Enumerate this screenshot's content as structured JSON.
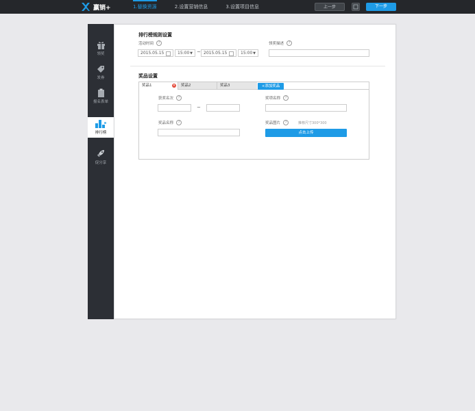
{
  "header": {
    "brand": "赢销+",
    "steps": [
      "1.替换资源",
      "2.设置营销信息",
      "3.设置项目信息"
    ],
    "prev_label": "上一步",
    "next_label": "下一步"
  },
  "sidebar": {
    "items": [
      {
        "label": "领奖",
        "icon": "gift-icon"
      },
      {
        "label": "发券",
        "icon": "tag-icon"
      },
      {
        "label": "报名表单",
        "icon": "clipboard-icon"
      },
      {
        "label": "排行榜",
        "icon": "ranking-icon",
        "active": true
      },
      {
        "label": "促分享",
        "icon": "rocket-icon"
      }
    ]
  },
  "rules": {
    "title": "排行榜规则设置",
    "time_label": "活动时间",
    "start_date": "2015.05.15",
    "start_time": "15:00",
    "separator": "~",
    "end_date": "2015.05.15",
    "end_time": "15:00",
    "desc_label": "领奖描述",
    "desc_value": ""
  },
  "prizes": {
    "title": "奖品设置",
    "tabs": [
      "奖品1",
      "奖品2",
      "奖品3"
    ],
    "add_label": "+添加奖品",
    "rank_label": "获奖名次",
    "rank_separator": "~",
    "award_name_label": "奖项名称",
    "prize_name_label": "奖品名称",
    "image_label": "奖品图片",
    "image_hint": "推荐尺寸300*300",
    "upload_label": "点击上传",
    "help_glyph": "?"
  },
  "colors": {
    "accent": "#1e9be6",
    "dark": "#2c2f35",
    "close": "#e34a3a"
  }
}
